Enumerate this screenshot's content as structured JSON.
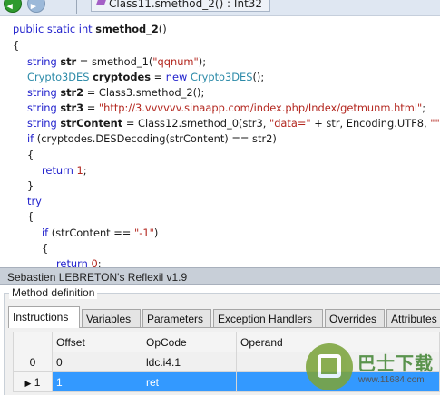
{
  "toolbar": {
    "tab_label": "Class11.smethod_2() : Int32",
    "back_icon": "back-arrow-icon",
    "forward_icon": "forward-arrow-icon"
  },
  "code": {
    "line1": {
      "kw": "public static int ",
      "name": "smethod_2",
      "rest": "()"
    },
    "line2": "{",
    "line3": {
      "kw": "string ",
      "var": "str",
      "mid": " = smethod_1(",
      "str": "\"qqnum\"",
      "end": ");"
    },
    "line4": {
      "ty": "Crypto3DES ",
      "var": "cryptodes",
      "mid": " = ",
      "kw": "new ",
      "ty2": "Crypto3DES",
      "end": "();"
    },
    "line5": {
      "kw": "string ",
      "var": "str2",
      "mid": " = Class3.smethod_2();"
    },
    "line6": {
      "kw": "string ",
      "var": "str3",
      "mid": " = ",
      "str": "\"http://3.vvvvvv.sinaapp.com/index.php/Index/getmunm.html\"",
      "end": ";"
    },
    "line7": {
      "kw": "string ",
      "var": "strContent",
      "mid": " = Class12.smethod_0(str3, ",
      "str": "\"data=\"",
      "mid2": " + str, Encoding.UTF8, ",
      "str2": "\"\"",
      "end": ");"
    },
    "line8": {
      "kw": "if",
      "rest": " (cryptodes.DESDecoding(strContent) == str2)"
    },
    "line9": "{",
    "line10": {
      "kw": "return ",
      "num": "1",
      "end": ";"
    },
    "line11": "}",
    "line12": "try",
    "line13": "{",
    "line14": {
      "kw": "if",
      "mid": " (strContent == ",
      "str": "\"-1\"",
      "end": ")"
    },
    "line15": "{",
    "line16": {
      "kw": "return ",
      "num": "0",
      "end": ";"
    }
  },
  "panel": {
    "title": "Sebastien LEBRETON's Reflexil v1.9",
    "group": "Method definition",
    "tabs": [
      "Instructions",
      "Variables",
      "Parameters",
      "Exception Handlers",
      "Overrides",
      "Attributes"
    ]
  },
  "grid": {
    "headers": [
      "Offset",
      "OpCode",
      "Operand"
    ],
    "rows": [
      {
        "index": "0",
        "offset": "0",
        "opcode": "ldc.i4.1",
        "operand": ""
      },
      {
        "index": "1",
        "offset": "1",
        "opcode": "ret",
        "operand": ""
      }
    ]
  },
  "watermark": {
    "brand": "巴士下载",
    "url": "www.11684.com"
  }
}
